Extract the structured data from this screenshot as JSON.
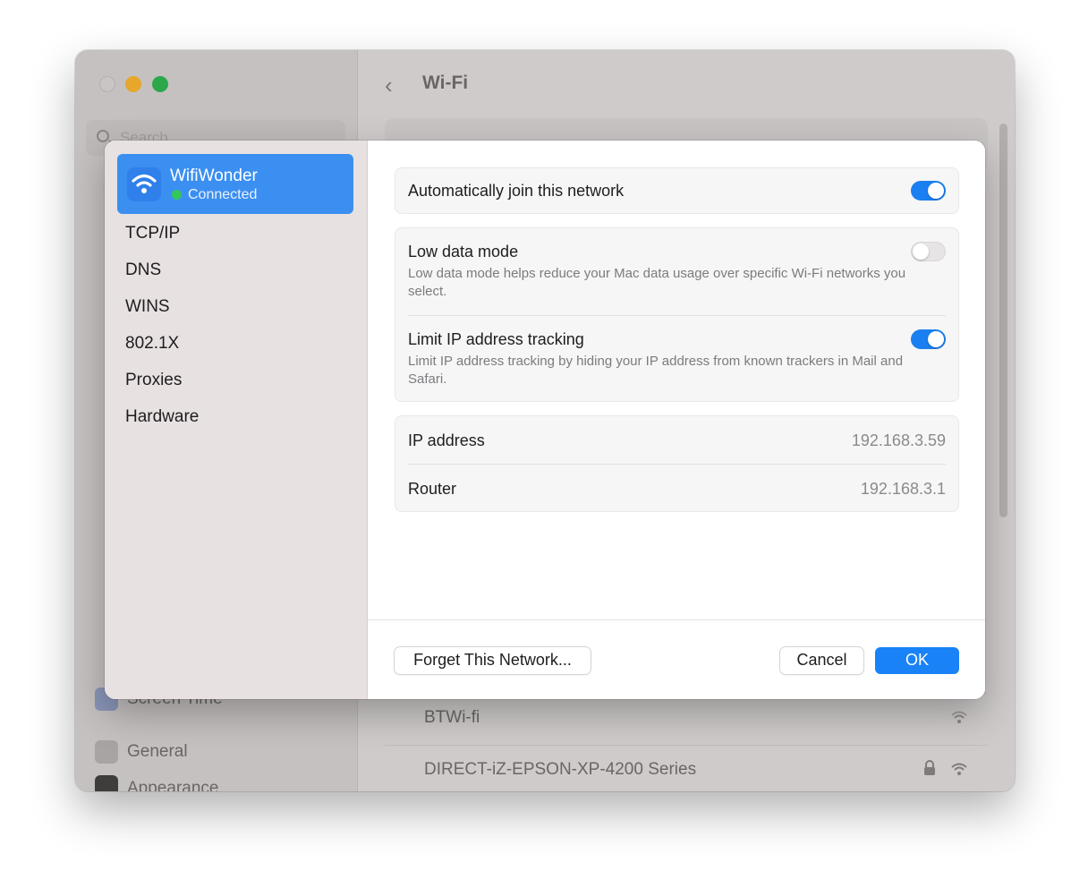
{
  "window": {
    "title": "Wi-Fi",
    "search_placeholder": "Search",
    "sidebar_items": [
      {
        "label": "Screen Time",
        "icon": "hourglass-icon"
      },
      {
        "label": "General",
        "icon": "gear-icon"
      },
      {
        "label": "Appearance",
        "icon": "appearance-icon"
      }
    ],
    "networks": [
      {
        "name": "BTWi-fi",
        "locked": false
      },
      {
        "name": "DIRECT-iZ-EPSON-XP-4200 Series",
        "locked": true
      }
    ]
  },
  "sheet": {
    "network": {
      "name": "WifiWonder",
      "status": "Connected",
      "icon": "wifi-icon"
    },
    "sidebar_items": [
      "TCP/IP",
      "DNS",
      "WINS",
      "802.1X",
      "Proxies",
      "Hardware"
    ],
    "auto_join": {
      "label": "Automatically join this network",
      "on": true
    },
    "low_data": {
      "label": "Low data mode",
      "description": "Low data mode helps reduce your Mac data usage over specific Wi-Fi networks you select.",
      "on": false
    },
    "limit_ip": {
      "label": "Limit IP address tracking",
      "description": "Limit IP address tracking by hiding your IP address from known trackers in Mail and Safari.",
      "on": true
    },
    "ip_address": {
      "label": "IP address",
      "value": "192.168.3.59"
    },
    "router": {
      "label": "Router",
      "value": "192.168.3.1"
    },
    "buttons": {
      "forget": "Forget This Network...",
      "cancel": "Cancel",
      "ok": "OK"
    }
  },
  "colors": {
    "accent": "#1a82f7",
    "connected": "#34c759",
    "selection": "#3b8ff1"
  }
}
